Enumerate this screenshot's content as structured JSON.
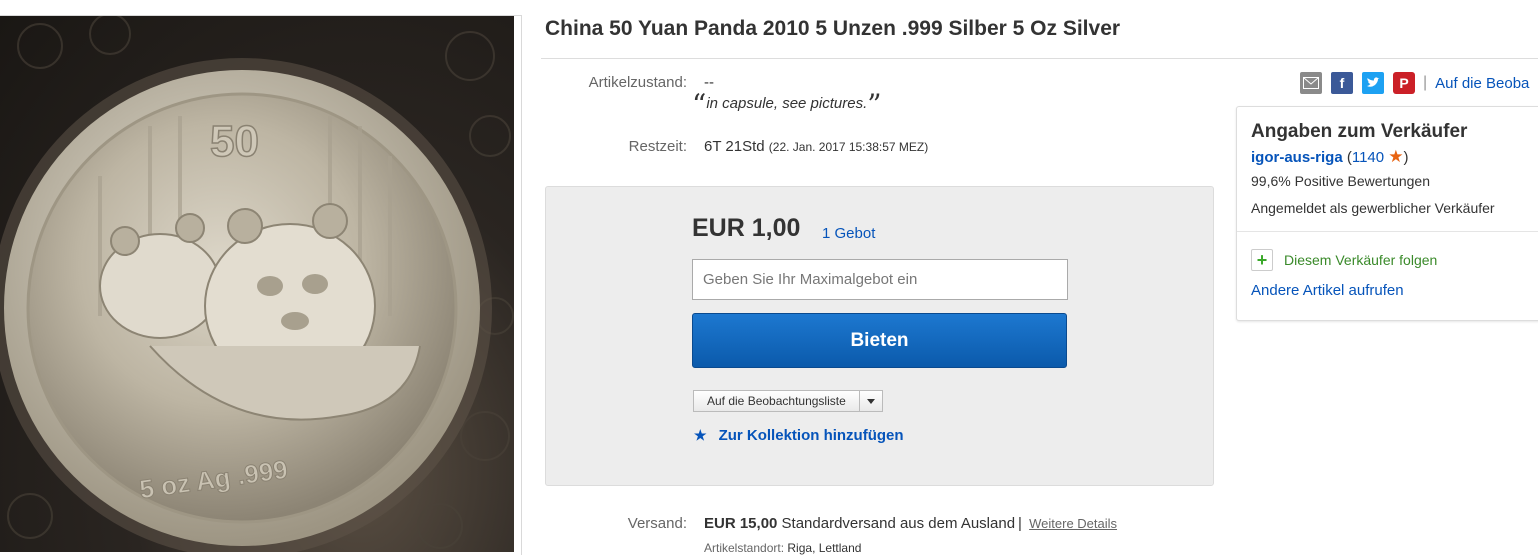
{
  "title": "China 50 Yuan Panda 2010 5 Unzen .999 Silber 5 Oz Silver",
  "photo": {
    "alt": ""
  },
  "condition": {
    "label": "Artikelzustand:",
    "value": "--",
    "note": "in capsule, see pictures."
  },
  "remaining": {
    "label": "Restzeit:",
    "value": "6T 21Std",
    "end": "(22. Jan. 2017   15:38:57 MEZ)"
  },
  "bid": {
    "price": "EUR 1,00",
    "count": "1 Gebot",
    "placeholder": "Geben Sie Ihr Maximalgebot ein",
    "button": "Bieten",
    "watch_label": "Auf die Beobachtungsliste",
    "collection": "Zur Kollektion hinzufügen"
  },
  "share": {
    "watch_link": "Auf die Beoba",
    "icons": [
      "mail-icon",
      "facebook-icon",
      "twitter-icon",
      "pinterest-icon"
    ]
  },
  "seller": {
    "heading": "Angaben zum Verkäufer",
    "name": "igor-aus-riga",
    "score": "1140",
    "positive": "99,6% Positive Bewertungen",
    "commercial": "Angemeldet als gewerblicher Verkäufer",
    "follow": "Diesem Verkäufer folgen",
    "other_items": "Andere Artikel aufrufen"
  },
  "shipping": {
    "label": "Versand:",
    "cost": "EUR 15,00",
    "method": "Standardversand aus dem Ausland",
    "details": "Weitere Details",
    "location_label": "Artikelstandort:",
    "location": "Riga, Lettland"
  },
  "colors": {
    "link": "#0654ba",
    "button": "#0b5aab",
    "star": "#e86412",
    "follow": "#3a8a2a"
  }
}
